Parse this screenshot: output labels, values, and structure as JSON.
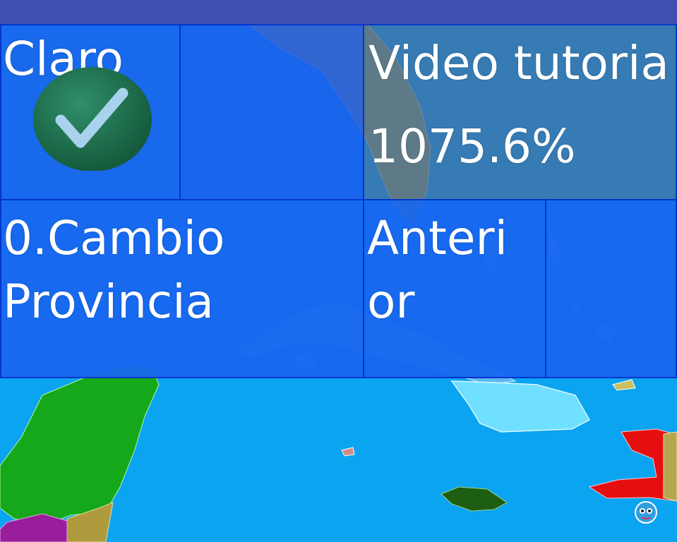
{
  "colors": {
    "topbar": "#3f4fb0",
    "sea": "#0aa4f0",
    "tile_blue": "#1866ee",
    "tile_dark": "#1f55d4",
    "tile_muted": "#3a7ab8",
    "check_green": "#1f6f4c"
  },
  "tiles": {
    "claro_label": "Claro",
    "video_label": "Video tutoria",
    "percentage": "1075.6%",
    "cambio_line1": "0.Cambio",
    "cambio_line2": "Provincia",
    "anterior_line1": "Anteri",
    "anterior_line2": "or"
  },
  "icons": {
    "check": "checkmark-circle-icon",
    "mascot": "mascot-icon"
  }
}
